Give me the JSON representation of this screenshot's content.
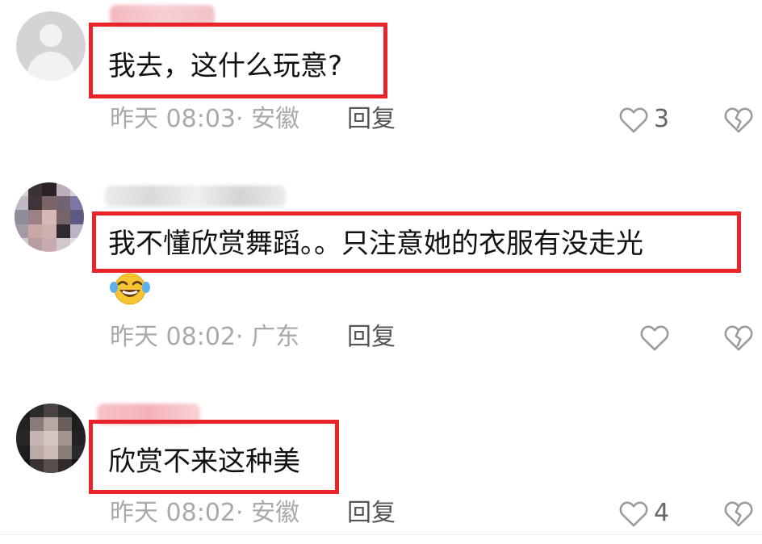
{
  "comments": [
    {
      "text": "我去，这什么玩意?",
      "timestamp": "昨天 08:03",
      "location": "· 安徽",
      "reply_label": "回复",
      "like_count": "3",
      "avatar": "default-avatar",
      "username_blurred": true
    },
    {
      "text": "我不懂欣赏舞蹈。。只注意她的衣服有没走光",
      "emoji": "laughing-crying-emoji",
      "timestamp": "昨天 08:02",
      "location": "· 广东",
      "reply_label": "回复",
      "like_count": "",
      "avatar": "pixelated-avatar",
      "username_blurred": true
    },
    {
      "text": "欣赏不来这种美",
      "timestamp": "昨天 08:02",
      "location": "· 安徽",
      "reply_label": "回复",
      "like_count": "4",
      "avatar": "pixelated-avatar",
      "username_blurred": true
    }
  ],
  "colors": {
    "highlight_border": "#e8242a",
    "meta_text": "#a9a9a9",
    "reply_text": "#555555",
    "icon_stroke": "#9a9a9a"
  },
  "icons": {
    "like": "heart-outline-icon",
    "dislike": "broken-heart-icon"
  }
}
